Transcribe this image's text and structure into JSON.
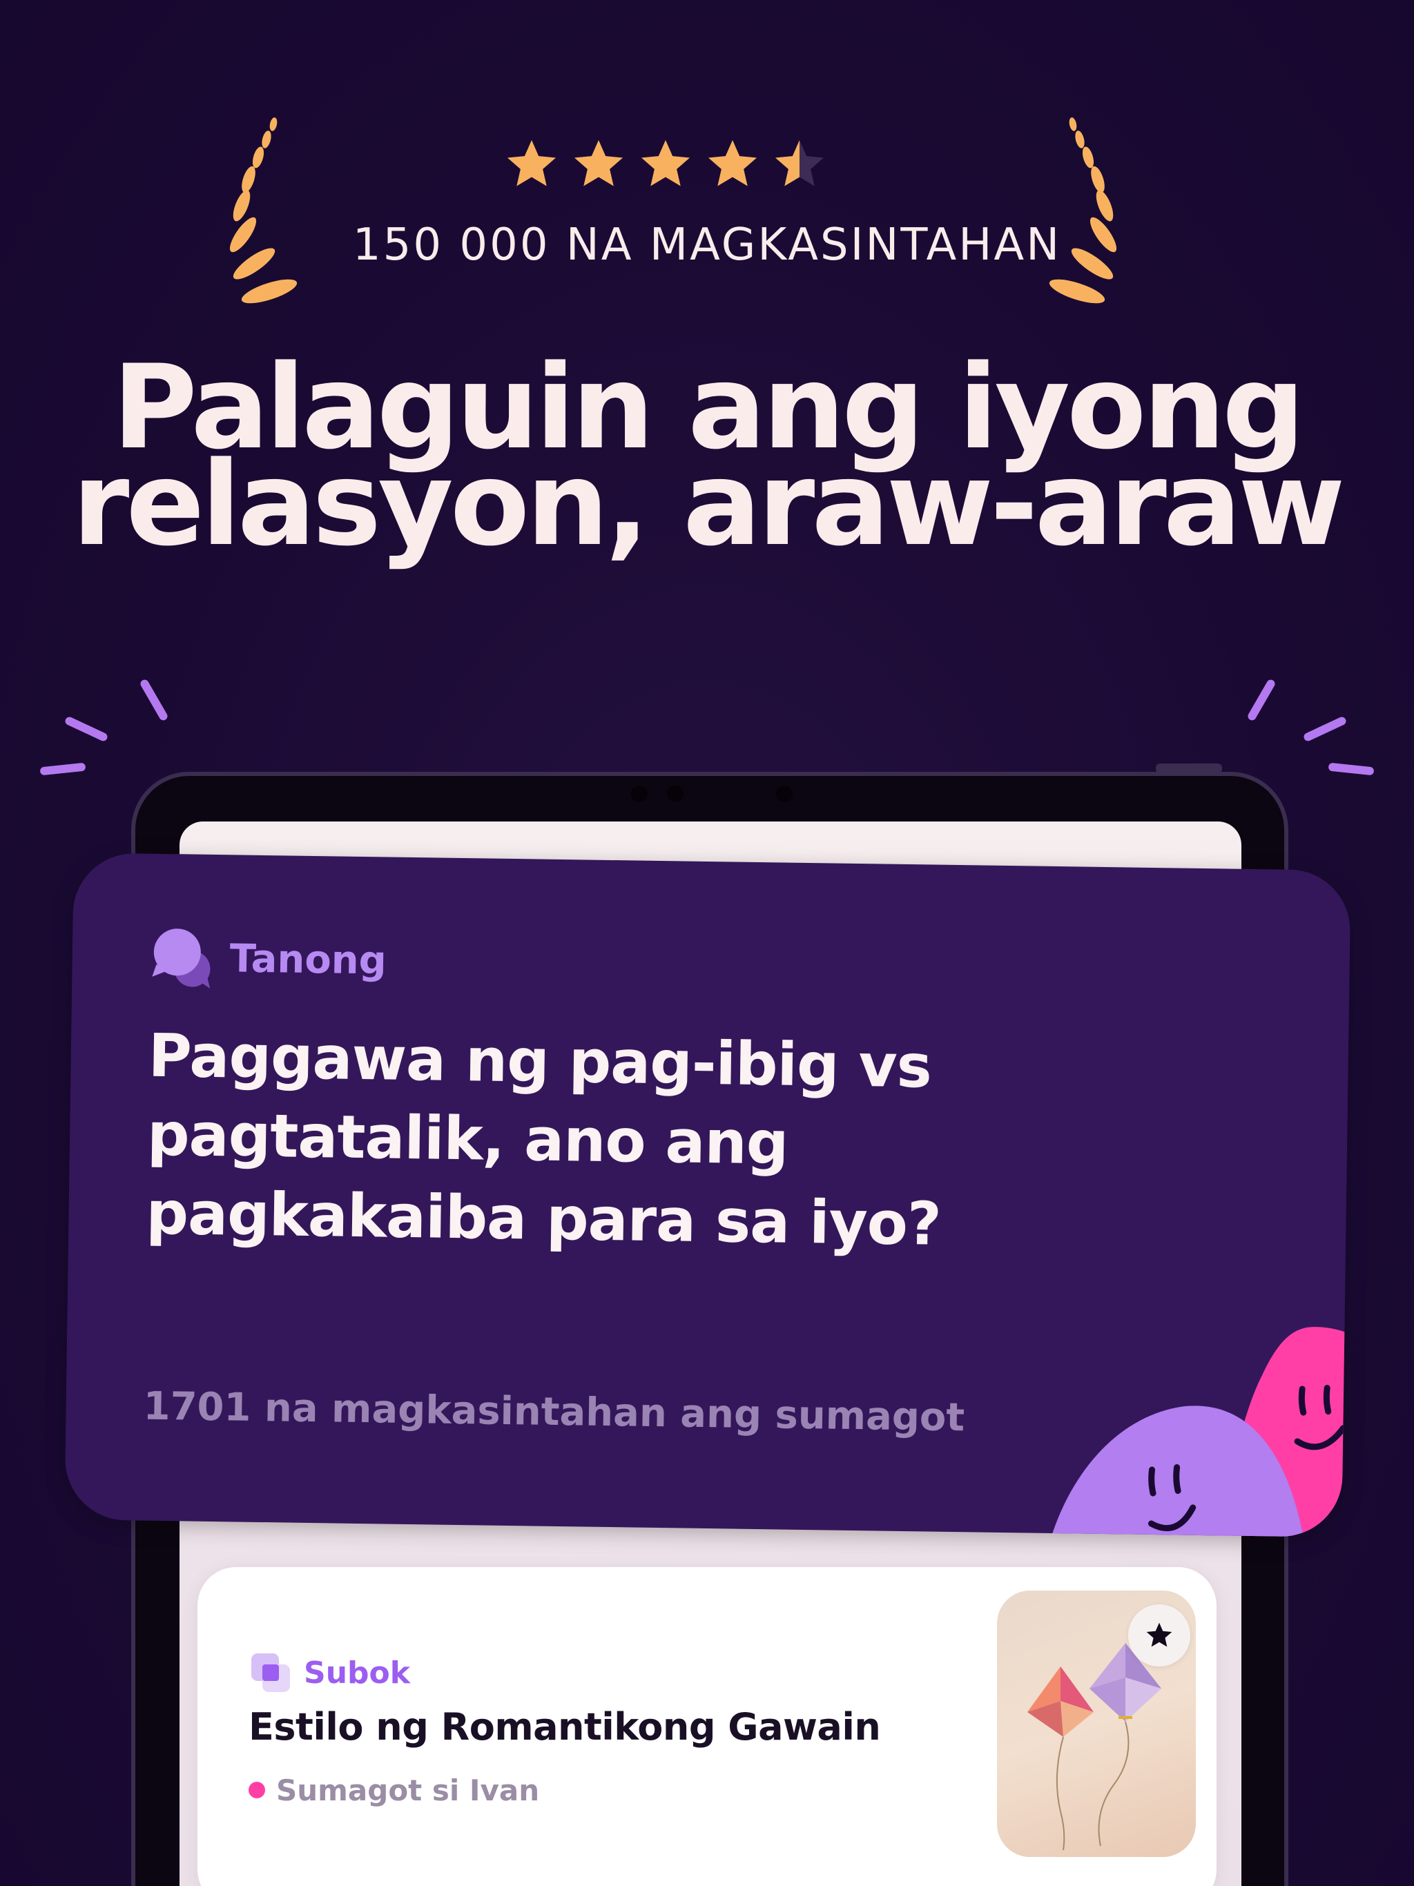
{
  "rating": {
    "value": 4.5,
    "max": 5,
    "star_color": "#f8b25f",
    "empty_color": "#3e2c57",
    "couples_count": "150 000 NA MAGKASINTAHAN"
  },
  "headline": {
    "line1": "Palaguin ang iyong",
    "line2": "relasyon, araw-araw"
  },
  "question_card": {
    "label": "Tanong",
    "icon": "chat-bubbles-icon",
    "question": "Paggawa ng pag-ibig vs pagtatalik, ano ang pagkakaiba para sa iyo?",
    "answered": "1701 na magkasintahan ang sumagot",
    "background": "#34175a",
    "accent": "#b68af1"
  },
  "challenge_card": {
    "label": "Subok",
    "icon": "layers-icon",
    "title": "Estilo ng Romantikong Gawain",
    "status": "Sumagot si Ivan",
    "status_color": "#ff3fa6",
    "accent": "#9b5ef0",
    "thumbnail": "kites-image",
    "favorite_icon": "star-icon"
  },
  "colors": {
    "background": "#1a0a33",
    "headline_text": "#fbecec",
    "sparkle": "#b479f0",
    "blob_pink": "#ff3fa6",
    "blob_purple": "#b27ef0"
  }
}
